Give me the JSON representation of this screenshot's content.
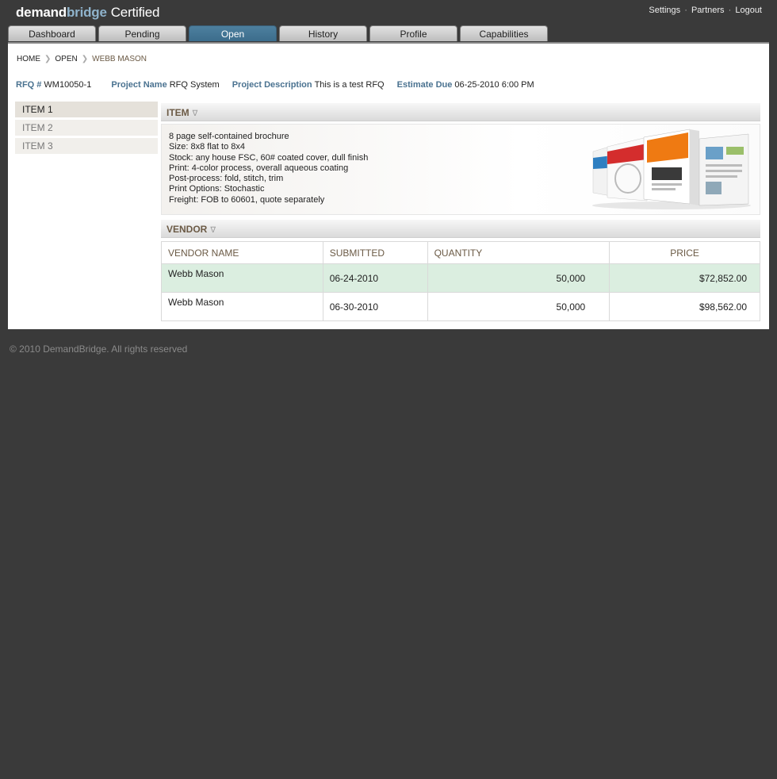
{
  "brand": {
    "part1": "demand",
    "part2": "bridge",
    "part3": "Certified"
  },
  "toplinks": [
    "Settings",
    "Partners",
    "Logout"
  ],
  "toplinks_sep": "·",
  "tabs": [
    "Dashboard",
    "Pending",
    "Open",
    "History",
    "Profile",
    "Capabilities"
  ],
  "active_tab": "Open",
  "breadcrumb": [
    "HOME",
    "OPEN",
    "WEBB MASON"
  ],
  "meta": {
    "rfq_label": "RFQ #",
    "rfq_value": "WM10050-1",
    "project_name_label": "Project Name",
    "project_name_value": "RFQ System",
    "project_desc_label": "Project Description",
    "project_desc_value": "This is a test RFQ",
    "estimate_due_label": "Estimate Due",
    "estimate_due_value": "06-25-2010 6:00 PM"
  },
  "items": [
    "ITEM 1",
    "ITEM 2",
    "ITEM 3"
  ],
  "selected_item": "ITEM 1",
  "item_section": {
    "title": "ITEM",
    "description": [
      "8 page self-contained brochure",
      "Size: 8x8 flat to 8x4",
      "Stock: any house FSC, 60# coated cover, dull finish",
      "Print: 4-color process, overall aqueous coating",
      "Post-process: fold, stitch, trim",
      "Print Options: Stochastic",
      "Freight: FOB to 60601, quote separately"
    ]
  },
  "vendor_section": {
    "title": "VENDOR",
    "columns": [
      "VENDOR NAME",
      "SUBMITTED",
      "QUANTITY",
      "PRICE"
    ],
    "rows": [
      {
        "vendor": "Webb Mason",
        "submitted": "06-24-2010",
        "quantity": "50,000",
        "price": "$72,852.00",
        "highlight": true
      },
      {
        "vendor": "Webb Mason",
        "submitted": "06-30-2010",
        "quantity": "50,000",
        "price": "$98,562.00",
        "highlight": false
      }
    ]
  },
  "footer": "© 2010 DemandBridge. All rights reserved",
  "colors": {
    "background": "#3a3a3a",
    "active_tab": "#4a7a99",
    "label_blue": "#4a7290",
    "brown": "#6b5a45",
    "row_highlight": "#dbeee0"
  }
}
